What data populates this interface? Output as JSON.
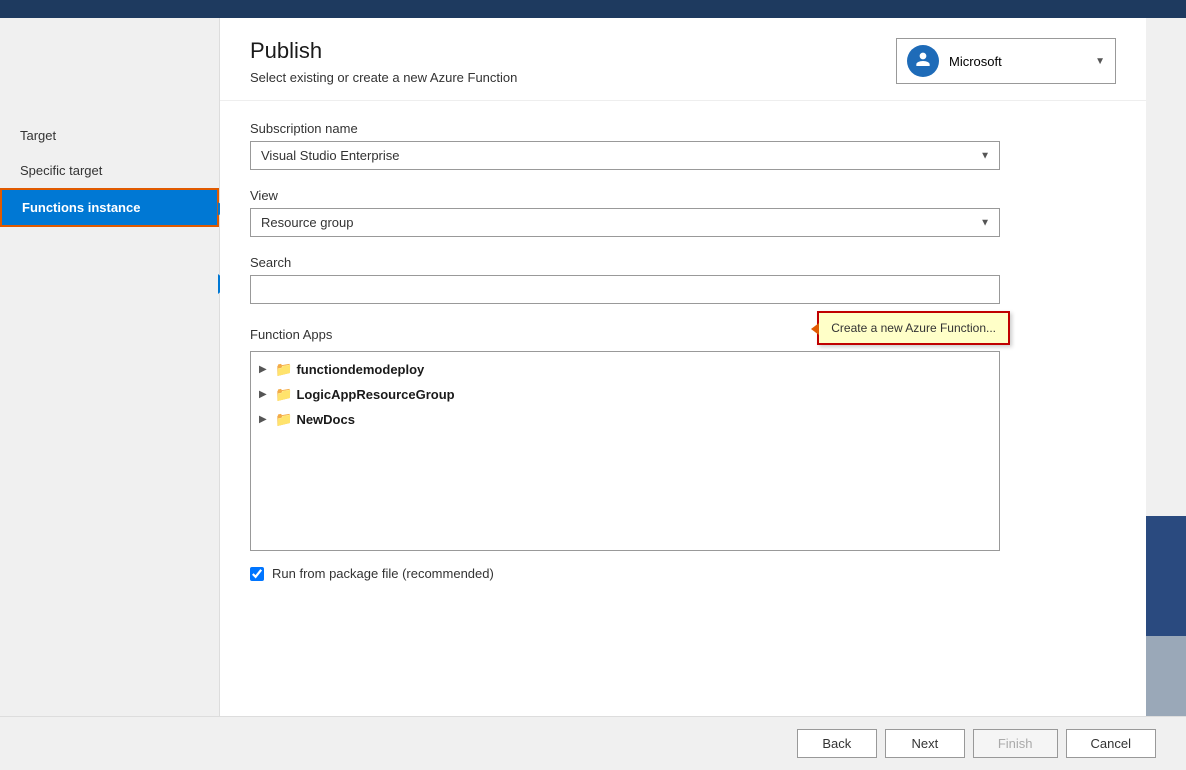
{
  "header": {
    "title": "Publish",
    "subtitle": "Select existing or create a new Azure Function",
    "account": {
      "name": "Microsoft",
      "icon": "👤"
    }
  },
  "sidebar": {
    "items": [
      {
        "id": "target",
        "label": "Target",
        "active": false
      },
      {
        "id": "specific-target",
        "label": "Specific target",
        "active": false
      },
      {
        "id": "functions-instance",
        "label": "Functions instance",
        "active": true
      }
    ]
  },
  "form": {
    "subscription_label": "Subscription name",
    "subscription_value": "Visual Studio Enterprise",
    "view_label": "View",
    "view_value": "Resource group",
    "search_label": "Search",
    "search_placeholder": "",
    "function_apps_label": "Function Apps",
    "create_tooltip": "Create a new Azure Function...",
    "items": [
      {
        "name": "functiondemodeploy",
        "icon": "📁"
      },
      {
        "name": "LogicAppResourceGroup",
        "icon": "📁"
      },
      {
        "name": "NewDocs",
        "icon": "📁"
      }
    ],
    "checkbox_label": "Run from package file (recommended)",
    "checkbox_checked": true
  },
  "footer": {
    "back_label": "Back",
    "next_label": "Next",
    "finish_label": "Finish",
    "cancel_label": "Cancel"
  }
}
